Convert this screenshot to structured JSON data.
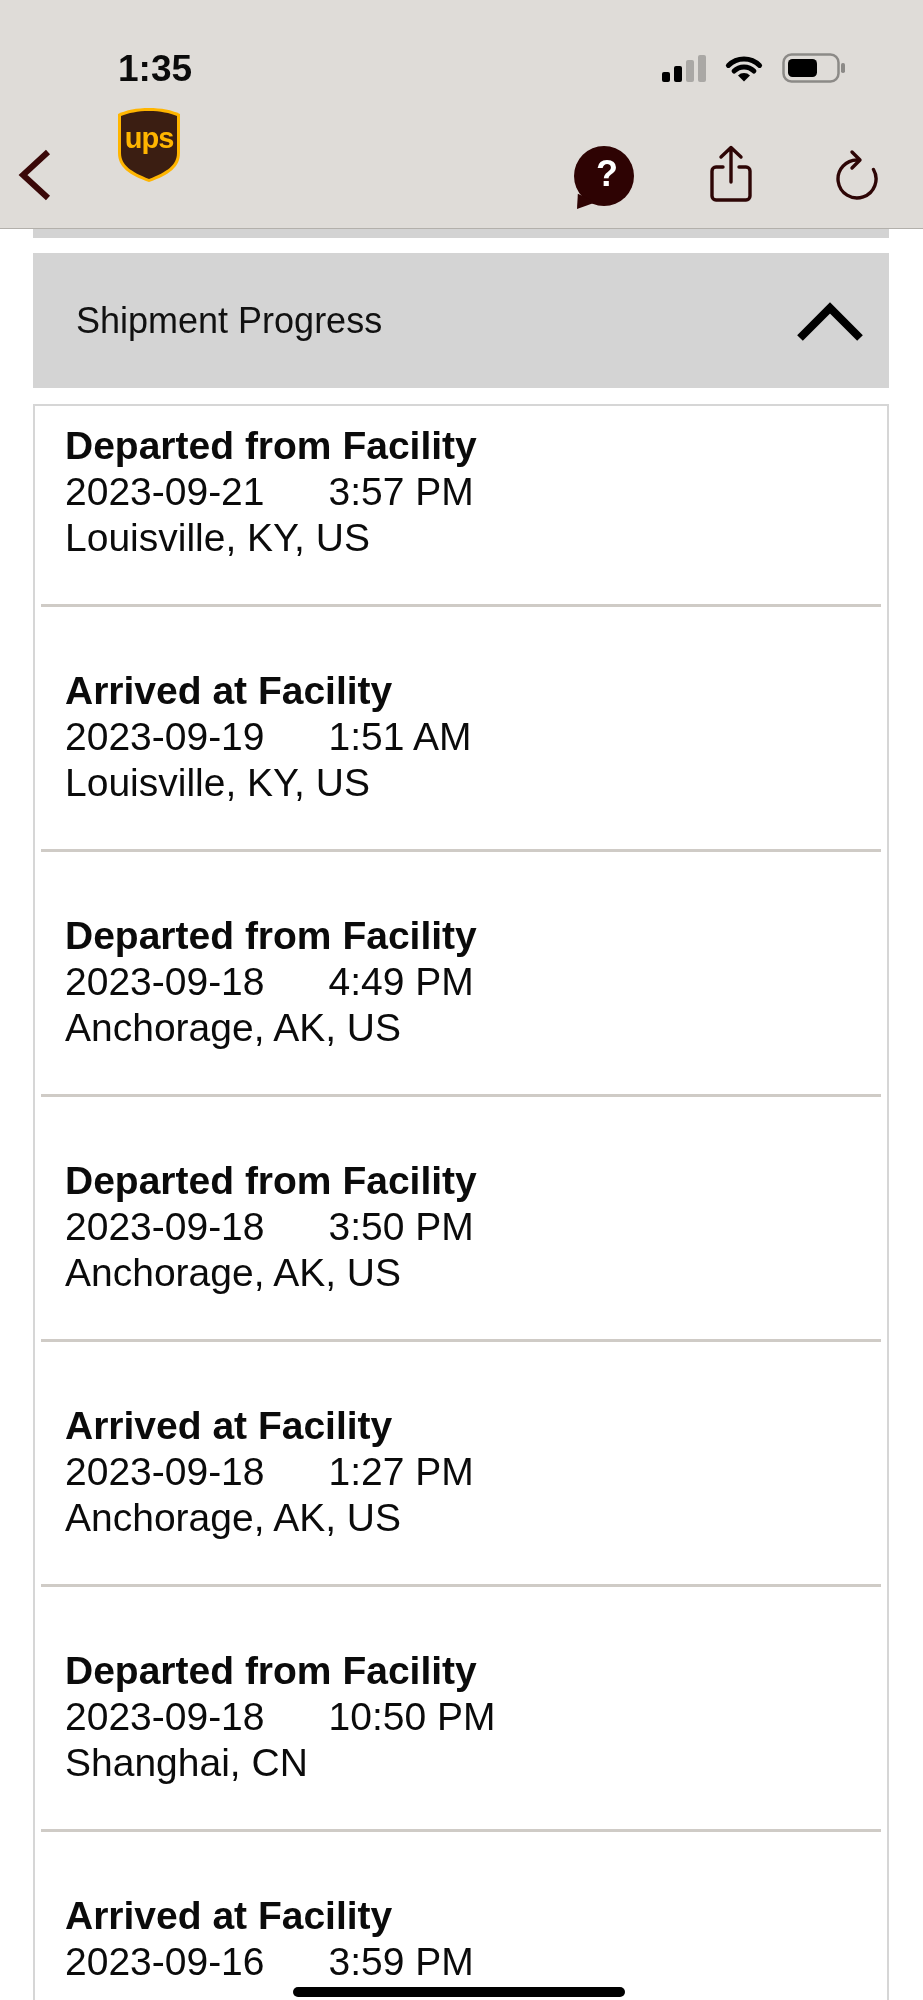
{
  "status_bar": {
    "time": "1:35"
  },
  "nav": {
    "logo_text": "ups",
    "help_label": "?"
  },
  "section": {
    "title": "Shipment Progress",
    "expanded": true
  },
  "events": [
    {
      "status": "Departed from Facility",
      "date": "2023-09-21",
      "time": "3:57 PM",
      "location": "Louisville, KY, US"
    },
    {
      "status": "Arrived at Facility",
      "date": "2023-09-19",
      "time": "1:51 AM",
      "location": "Louisville, KY, US"
    },
    {
      "status": "Departed from Facility",
      "date": "2023-09-18",
      "time": "4:49 PM",
      "location": "Anchorage, AK, US"
    },
    {
      "status": "Departed from Facility",
      "date": "2023-09-18",
      "time": "3:50 PM",
      "location": "Anchorage, AK, US"
    },
    {
      "status": "Arrived at Facility",
      "date": "2023-09-18",
      "time": "1:27 PM",
      "location": "Anchorage, AK, US"
    },
    {
      "status": "Departed from Facility",
      "date": "2023-09-18",
      "time": "10:50 PM",
      "location": "Shanghai, CN"
    },
    {
      "status": "Arrived at Facility",
      "date": "2023-09-16",
      "time": "3:59 PM"
    }
  ]
}
